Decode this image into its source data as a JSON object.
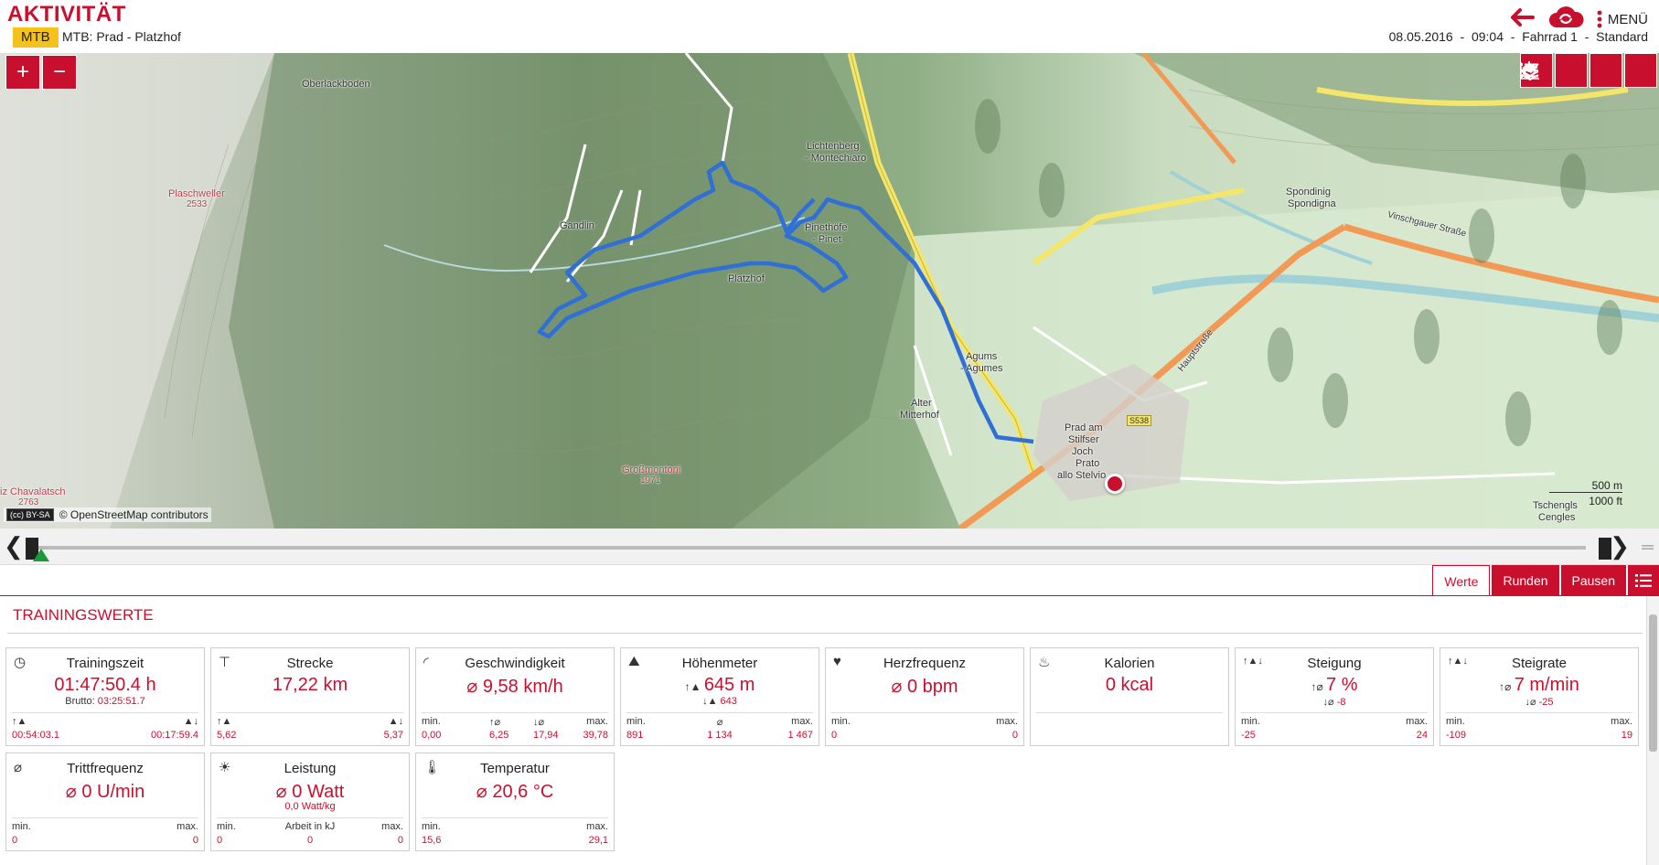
{
  "header": {
    "title": "AKTIVITÄT",
    "sport": "MTB",
    "activity_name": "MTB: Prad - Platzhof",
    "back_icon": "back-arrow-icon",
    "sync_icon": "cloud-sync-icon",
    "menu_label": "MENÜ",
    "date": "08.05.2016",
    "time": "09:04",
    "bike": "Fahrrad 1",
    "profile": "Standard",
    "sep": "-"
  },
  "map": {
    "zoom_in": "+",
    "zoom_out": "−",
    "attribution": "© OpenStreetMap contributors",
    "cc": "(cc) BY-SA",
    "scale_m": "500 m",
    "scale_ft": "1000 ft",
    "labels": {
      "oberlackboden": "Oberlackboden",
      "plaschweller": "Plaschweller",
      "plaschweller_alt": "2533",
      "gandlin": "Gandlin",
      "lichtenberg": "Lichtenberg",
      "montechiaro": "- Montechiaro",
      "pinethofe": "Pinethöfe",
      "pinet": "- Pinet",
      "platzhof": "Platzhof",
      "agums": "Agums",
      "agumes": "- Agumes",
      "alter": "Alter",
      "mitterhof": "Mitterhof",
      "prad": "Prad am",
      "stilfser": "Stilfser",
      "joch": "Joch",
      "prato": "Prato",
      "stelvio": "allo Stelvio",
      "spondinig": "Spondinig",
      "spondigna": "Spondigna",
      "grossmontoni": "Großmontoni",
      "grossmontoni_alt": "1971",
      "chavalatsch": "iz Chavalatsch",
      "chavalatsch_alt": "2763",
      "tschengls": "Tschengls",
      "cengles": "Cengles",
      "s538": "S538",
      "hauptstrasse": "Hauptstraße",
      "vinschgauer": "Vinschgauer Straße"
    }
  },
  "tabs": {
    "werte": "Werte",
    "runden": "Runden",
    "pausen": "Pausen"
  },
  "section_title": "TRAININGSWERTE",
  "cards": {
    "trainingszeit": {
      "title": "Trainingszeit",
      "value": "01:47:50.4 h",
      "brutto_label": "Brutto:",
      "brutto": "03:25:51.7",
      "up": "00:54:03.1",
      "down": "00:17:59.4"
    },
    "strecke": {
      "title": "Strecke",
      "value": "17,22 km",
      "up": "5,62",
      "down": "5,37"
    },
    "geschwindigkeit": {
      "title": "Geschwindigkeit",
      "value": "⌀ 9,58 km/h",
      "min_label": "min.",
      "max_label": "max.",
      "min": "0,00",
      "avg_up": "6,25",
      "avg_down": "17,94",
      "max": "39,78"
    },
    "hoehenmeter": {
      "title": "Höhenmeter",
      "value": "645 m",
      "sub": "643",
      "min_label": "min.",
      "avg_label": "⌀",
      "max_label": "max.",
      "min": "891",
      "avg": "1 134",
      "max": "1 467"
    },
    "herzfrequenz": {
      "title": "Herzfrequenz",
      "value": "⌀ 0 bpm",
      "min_label": "min.",
      "max_label": "max.",
      "min": "0",
      "max": "0"
    },
    "kalorien": {
      "title": "Kalorien",
      "value": "0 kcal"
    },
    "steigung": {
      "title": "Steigung",
      "value": "7 %",
      "sub": "-8",
      "min_label": "min.",
      "max_label": "max.",
      "min": "-25",
      "max": "24"
    },
    "steigrate": {
      "title": "Steigrate",
      "value": "7 m/min",
      "sub": "-25",
      "min_label": "min.",
      "max_label": "max.",
      "min": "-109",
      "max": "19"
    },
    "trittfrequenz": {
      "title": "Trittfrequenz",
      "value": "⌀ 0 U/min",
      "min_label": "min.",
      "max_label": "max.",
      "min": "0",
      "max": "0"
    },
    "leistung": {
      "title": "Leistung",
      "value": "⌀ 0 Watt",
      "sub": "0,0 Watt/kg",
      "min_label": "min.",
      "mid_label": "Arbeit in kJ",
      "max_label": "max.",
      "min": "0",
      "mid": "0",
      "max": "0"
    },
    "temperatur": {
      "title": "Temperatur",
      "value": "⌀ 20,6 °C",
      "min_label": "min.",
      "max_label": "max.",
      "min": "15,6",
      "max": "29,1"
    }
  },
  "colors": {
    "accent": "#c8102e",
    "badge": "#f4c21a",
    "route": "#2f6fd6",
    "marker": "#1a9a3a"
  }
}
